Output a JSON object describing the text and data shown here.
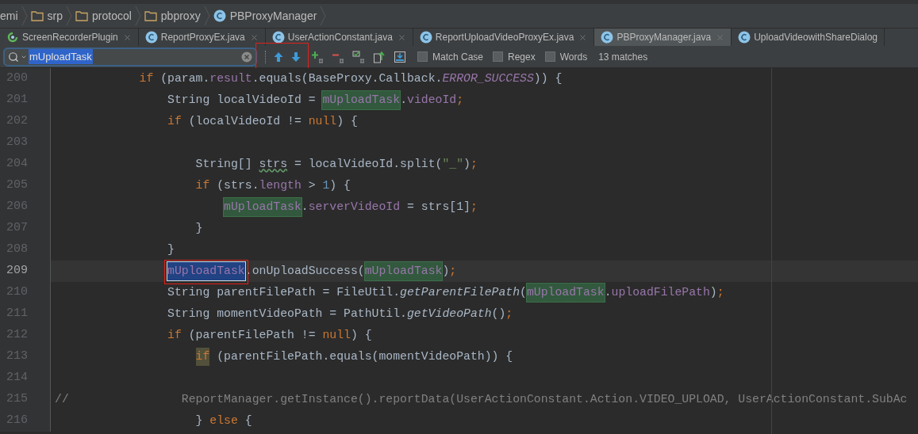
{
  "breadcrumbs": [
    {
      "label": "emi",
      "kind": "text"
    },
    {
      "label": "srp",
      "kind": "folder"
    },
    {
      "label": "protocol",
      "kind": "folder"
    },
    {
      "label": "pbproxy",
      "kind": "folder"
    },
    {
      "label": "PBProxyManager",
      "kind": "class"
    }
  ],
  "tabs": [
    {
      "label": "ScreenRecorderPlugin",
      "kind": "plugin",
      "selected": false,
      "closable": true
    },
    {
      "label": "ReportProxyEx.java",
      "kind": "class",
      "selected": false,
      "closable": true
    },
    {
      "label": "UserActionConstant.java",
      "kind": "class",
      "selected": false,
      "closable": true
    },
    {
      "label": "ReportUploadVideoProxyEx.java",
      "kind": "class",
      "selected": false,
      "closable": true
    },
    {
      "label": "PBProxyManager.java",
      "kind": "class",
      "selected": true,
      "closable": true
    },
    {
      "label": "UploadVideowithShareDialog",
      "kind": "class",
      "selected": false,
      "closable": false
    }
  ],
  "search": {
    "value": "mUploadTask",
    "options": [
      {
        "label": "Match Case",
        "checked": false
      },
      {
        "label": "Regex",
        "checked": false
      },
      {
        "label": "Words",
        "checked": false
      }
    ],
    "result": "13 matches"
  },
  "code": [
    {
      "number": "200",
      "current": false,
      "tokens": [
        {
          "kind": "keyword",
          "text": "if"
        },
        {
          "kind": "plain",
          "text": " (param."
        },
        {
          "kind": "field",
          "text": "result"
        },
        {
          "kind": "plain",
          "text": ".equals(BaseProxy.Callback."
        },
        {
          "kind": "static_field",
          "text": "ERROR_SUCCESS"
        },
        {
          "kind": "plain",
          "text": ")) {"
        }
      ],
      "children": [
        {
          "number": "201",
          "current": false,
          "tokens": [
            {
              "kind": "plain",
              "text": "String localVideoId = "
            },
            {
              "kind": "match",
              "text": "mUploadTask"
            },
            {
              "kind": "plain",
              "text": "."
            },
            {
              "kind": "field",
              "text": "videoId"
            },
            {
              "kind": "keyword",
              "text": ";"
            }
          ]
        },
        {
          "number": "202",
          "current": false,
          "tokens": [
            {
              "kind": "keyword",
              "text": "if"
            },
            {
              "kind": "plain",
              "text": " (localVideoId != "
            },
            {
              "kind": "keyword",
              "text": "null"
            },
            {
              "kind": "plain",
              "text": ") {"
            }
          ],
          "children": [
            {
              "number": "203",
              "current": false
            },
            {
              "number": "204",
              "current": false,
              "tokens": [
                {
                  "kind": "plain",
                  "text": "String[] "
                },
                {
                  "kind": "typo",
                  "text": "strs"
                },
                {
                  "kind": "plain",
                  "text": " = localVideoId.split("
                },
                {
                  "kind": "string",
                  "text": "\"_\""
                },
                {
                  "kind": "plain",
                  "text": ")"
                },
                {
                  "kind": "keyword",
                  "text": ";"
                }
              ]
            },
            {
              "number": "205",
              "current": false,
              "tokens": [
                {
                  "kind": "keyword",
                  "text": "if"
                },
                {
                  "kind": "plain",
                  "text": " (strs."
                },
                {
                  "kind": "field",
                  "text": "length"
                },
                {
                  "kind": "plain",
                  "text": " > "
                },
                {
                  "kind": "number",
                  "text": "1"
                },
                {
                  "kind": "plain",
                  "text": ") {"
                }
              ],
              "children": [
                {
                  "number": "206",
                  "current": false,
                  "tokens": [
                    {
                      "kind": "match",
                      "text": "mUploadTask"
                    },
                    {
                      "kind": "plain",
                      "text": "."
                    },
                    {
                      "kind": "field",
                      "text": "serverVideoId"
                    },
                    {
                      "kind": "plain",
                      "text": " = strs[1]"
                    },
                    {
                      "kind": "keyword",
                      "text": ";"
                    }
                  ]
                }
              ]
            },
            {
              "number": "207",
              "current": false,
              "tokens": [
                {
                  "kind": "plain",
                  "text": "}"
                }
              ]
            }
          ]
        },
        {
          "number": "208",
          "current": false,
          "tokens": [
            {
              "kind": "plain",
              "text": "}"
            }
          ]
        },
        {
          "number": "209",
          "current": true,
          "tokens": [
            {
              "kind": "current_match",
              "text": "mUploadTask"
            },
            {
              "kind": "plain",
              "text": ".onUploadSuccess("
            },
            {
              "kind": "match",
              "text": "mUploadTask"
            },
            {
              "kind": "plain",
              "text": ")"
            },
            {
              "kind": "keyword",
              "text": ";"
            }
          ]
        },
        {
          "number": "210",
          "current": false,
          "tokens": [
            {
              "kind": "plain",
              "text": "String parentFilePath = FileUtil."
            },
            {
              "kind": "static_method",
              "text": "getParentFilePath"
            },
            {
              "kind": "plain",
              "text": "("
            },
            {
              "kind": "match",
              "text": "mUploadTask"
            },
            {
              "kind": "plain",
              "text": "."
            },
            {
              "kind": "field",
              "text": "uploadFilePath"
            },
            {
              "kind": "plain",
              "text": ")"
            },
            {
              "kind": "keyword",
              "text": ";"
            }
          ]
        },
        {
          "number": "211",
          "current": false,
          "tokens": [
            {
              "kind": "plain",
              "text": "String momentVideoPath = PathUtil."
            },
            {
              "kind": "static_method",
              "text": "getVideoPath"
            },
            {
              "kind": "plain",
              "text": "()"
            },
            {
              "kind": "keyword",
              "text": ";"
            }
          ]
        },
        {
          "number": "212",
          "current": false,
          "tokens": [
            {
              "kind": "keyword",
              "text": "if"
            },
            {
              "kind": "plain",
              "text": " (parentFilePath != "
            },
            {
              "kind": "keyword",
              "text": "null"
            },
            {
              "kind": "plain",
              "text": ") {"
            }
          ],
          "children": [
            {
              "number": "213",
              "current": false,
              "tokens": [
                {
                  "kind": "marked_keyword",
                  "text": "if"
                },
                {
                  "kind": "plain",
                  "text": " (parentFilePath.equals(momentVideoPath)) {"
                }
              ],
              "children": [
                {
                  "number": "214",
                  "current": false
                },
                {
                  "number": "215",
                  "current": false,
                  "tokens": [
                    {
                      "kind": "comment",
                      "text": "//                ReportManager.getInstance().reportData(UserActionConstant.Action.VIDEO_UPLOAD, UserActionConstant.SubAc"
                    }
                  ]
                }
              ]
            },
            {
              "number": "216",
              "current": false,
              "tokens": [
                {
                  "kind": "plain",
                  "text": "} "
                },
                {
                  "kind": "keyword",
                  "text": "else"
                },
                {
                  "kind": "plain",
                  "text": " {"
                }
              ]
            }
          ]
        }
      ]
    }
  ]
}
